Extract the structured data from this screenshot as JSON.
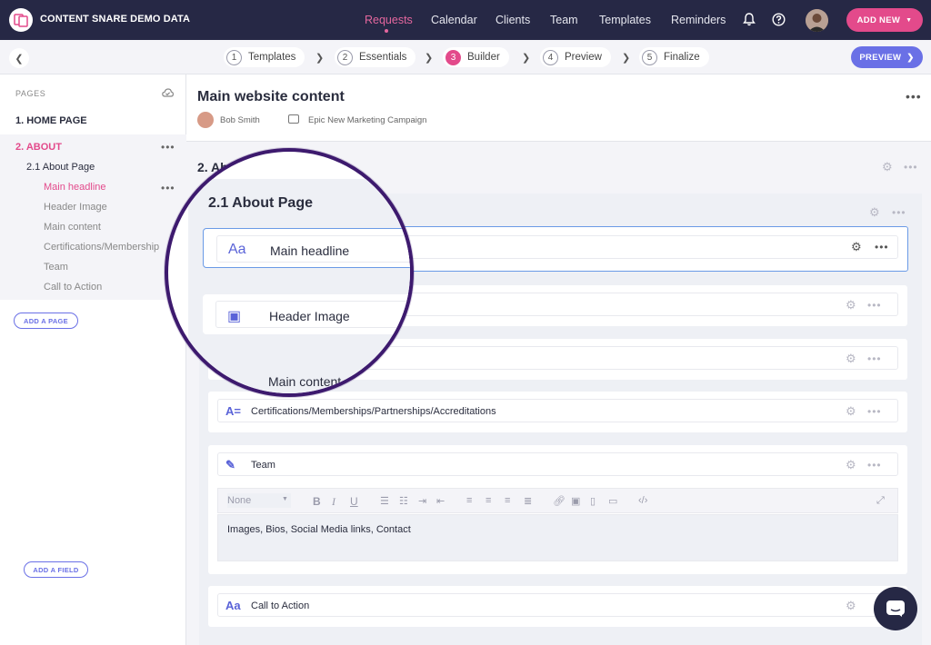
{
  "app": {
    "title": "CONTENT SNARE DEMO DATA"
  },
  "nav": {
    "items": [
      "Requests",
      "Calendar",
      "Clients",
      "Team",
      "Templates",
      "Reminders"
    ],
    "add_new": "ADD NEW"
  },
  "steps": [
    {
      "num": "1",
      "label": "Templates"
    },
    {
      "num": "2",
      "label": "Essentials"
    },
    {
      "num": "3",
      "label": "Builder"
    },
    {
      "num": "4",
      "label": "Preview"
    },
    {
      "num": "5",
      "label": "Finalize"
    }
  ],
  "preview_button": "PREVIEW",
  "sidebar": {
    "pages_label": "PAGES",
    "home": "1. HOME PAGE",
    "about": "2. ABOUT",
    "subpage": "2.1 About Page",
    "items": [
      "Main headline",
      "Header Image",
      "Main content",
      "Certifications/Membership",
      "Team",
      "Call to Action"
    ],
    "add_page": "ADD A PAGE"
  },
  "main": {
    "title": "Main website content",
    "author": "Bob Smith",
    "campaign": "Epic New Marketing Campaign",
    "section": "2.  Ab",
    "subsection": "2.1  About Page",
    "fields": [
      {
        "icon": "Aa",
        "label": "Main headline"
      },
      {
        "icon": "▣",
        "label": "Header Image"
      },
      {
        "icon": "≡",
        "label": "Main content"
      },
      {
        "icon": "A=",
        "label": "Certifications/Memberships/Partnerships/Accreditations"
      },
      {
        "icon": "✎",
        "label": "Team"
      },
      {
        "icon": "Aa",
        "label": "Call to Action"
      }
    ],
    "editor": {
      "format": "None",
      "body": "Images, Bios, Social Media links, Contact"
    },
    "add_field": "ADD A FIELD"
  },
  "colors": {
    "nav_bg": "#262845",
    "accent_pink": "#e34a8b",
    "accent_blue": "#6a70e6",
    "magnifier": "#3d1a6e"
  }
}
